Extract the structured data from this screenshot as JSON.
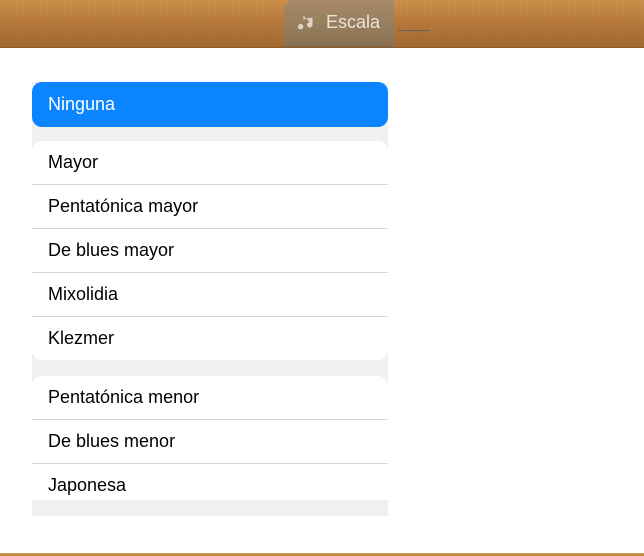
{
  "header": {
    "scale_button_label": "Escala"
  },
  "popup": {
    "selected": "Ninguna",
    "groups": [
      {
        "items": [
          "Mayor",
          "Pentatónica mayor",
          "De blues mayor",
          "Mixolidia",
          "Klezmer"
        ]
      },
      {
        "items": [
          "Pentatónica menor",
          "De blues menor",
          "Japonesa"
        ]
      }
    ]
  }
}
